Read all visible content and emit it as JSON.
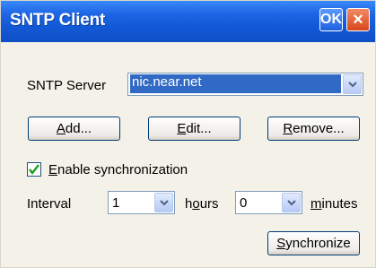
{
  "window": {
    "title": "SNTP Client",
    "ok_label": "OK",
    "close_label": "×"
  },
  "server": {
    "label": "SNTP Server",
    "value": "nic.near.net"
  },
  "buttons": {
    "add": {
      "mnemonic": "A",
      "rest": "dd..."
    },
    "edit": {
      "mnemonic": "E",
      "rest": "dit..."
    },
    "remove": {
      "mnemonic": "R",
      "rest": "emove..."
    },
    "synchronize": {
      "mnemonic": "S",
      "rest": "ynchronize"
    }
  },
  "sync": {
    "enabled": true,
    "label_mnemonic": "E",
    "label_rest": "nable synchronization"
  },
  "interval": {
    "label": "Interval",
    "hours_value": "1",
    "hours_pre": "h",
    "hours_mnemonic": "o",
    "hours_post": "urs",
    "minutes_value": "0",
    "minutes_mnemonic": "m",
    "minutes_rest": "inutes"
  },
  "colors": {
    "accent": "#1359d8",
    "selection": "#316ac5",
    "checkmark": "#21a121"
  }
}
